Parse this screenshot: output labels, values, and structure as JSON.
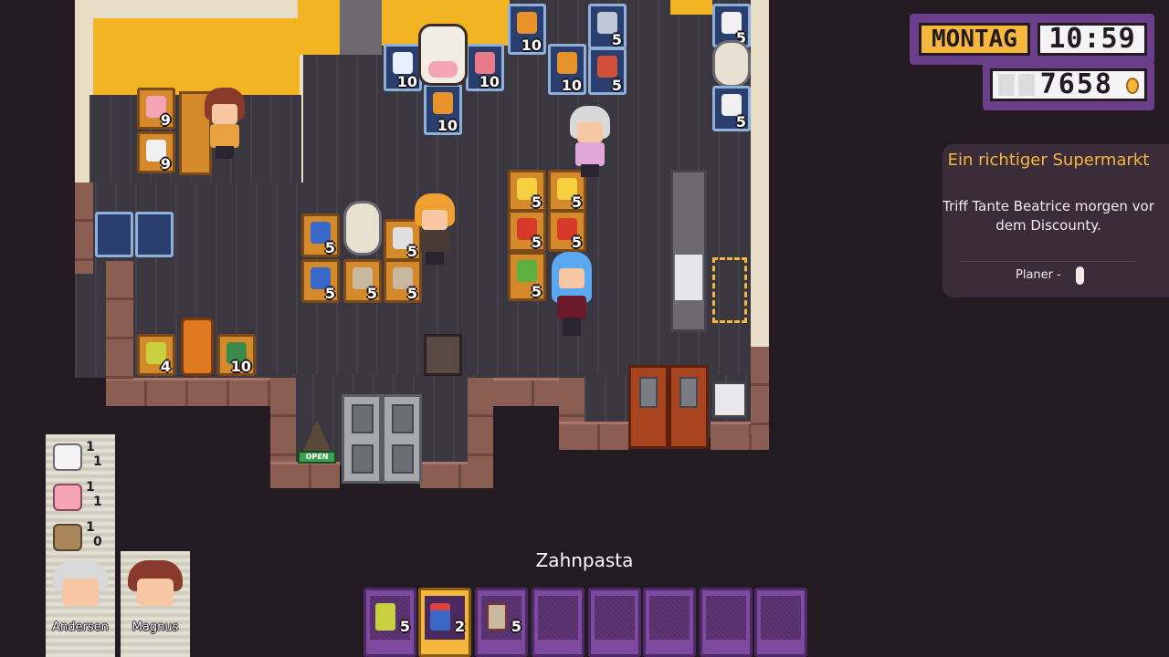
{
  "hud": {
    "day": "MONTAG",
    "time": "10:59",
    "money": "7658",
    "colors": {
      "accent": "#f6b83c",
      "frame": "#6b3e8c"
    }
  },
  "quest": {
    "title": "Ein richtiger Supermarkt",
    "text": "Triff Tante Beatrice morgen vor dem Discounty.",
    "planner_label": "Planer -",
    "icon": "mouse-icon"
  },
  "hotbar": {
    "selected_item": "Zahnpasta",
    "slots": [
      {
        "icon": "drink-can-icon",
        "qty": "5"
      },
      {
        "icon": "toothpaste-icon",
        "qty": "2"
      },
      {
        "icon": "soup-box-icon",
        "qty": "5"
      },
      {
        "icon": "",
        "qty": ""
      },
      {
        "icon": "",
        "qty": ""
      },
      {
        "icon": "",
        "qty": ""
      },
      {
        "icon": "",
        "qty": ""
      },
      {
        "icon": "",
        "qty": ""
      }
    ]
  },
  "staff": [
    {
      "name": "Andersen",
      "stock": [
        {
          "icon": "toilet-paper-icon",
          "num": "1",
          "den": "1"
        },
        {
          "icon": "lotion-bottle-icon",
          "num": "1",
          "den": "1"
        },
        {
          "icon": "bread-icon",
          "num": "1",
          "den": "0"
        }
      ]
    },
    {
      "name": "Magnus"
    }
  ],
  "map": {
    "shelves": [
      {
        "id": "shelf-a1",
        "qty": "9"
      },
      {
        "id": "shelf-a2",
        "qty": "9"
      },
      {
        "id": "fridge-b1",
        "qty": "10"
      },
      {
        "id": "fridge-b2",
        "qty": "10"
      },
      {
        "id": "fridge-b3",
        "qty": "10"
      },
      {
        "id": "fridge-c1",
        "qty": "10"
      },
      {
        "id": "fridge-c2",
        "qty": "5"
      },
      {
        "id": "fridge-c3",
        "qty": "10"
      },
      {
        "id": "fridge-c4",
        "qty": "5"
      },
      {
        "id": "fridge-d1",
        "qty": "5"
      },
      {
        "id": "fridge-d2",
        "qty": "5"
      },
      {
        "id": "shelf-e1",
        "qty": "5"
      },
      {
        "id": "shelf-e2",
        "qty": "5"
      },
      {
        "id": "shelf-e3",
        "qty": "5"
      },
      {
        "id": "shelf-e4",
        "qty": "5"
      },
      {
        "id": "shelf-e5",
        "qty": "5"
      },
      {
        "id": "shelf-f1",
        "qty": "5"
      },
      {
        "id": "shelf-f2",
        "qty": "5"
      },
      {
        "id": "shelf-f3",
        "qty": "5"
      },
      {
        "id": "shelf-f4",
        "qty": "5"
      },
      {
        "id": "shelf-f5",
        "qty": "5"
      },
      {
        "id": "shelf-g1",
        "qty": "4"
      },
      {
        "id": "shelf-g2",
        "qty": "10"
      }
    ],
    "open_sign": "OPEN",
    "colors": {
      "floor": "#3d3a44",
      "wall": "#f2b423",
      "brick": "#8a5e52"
    }
  }
}
